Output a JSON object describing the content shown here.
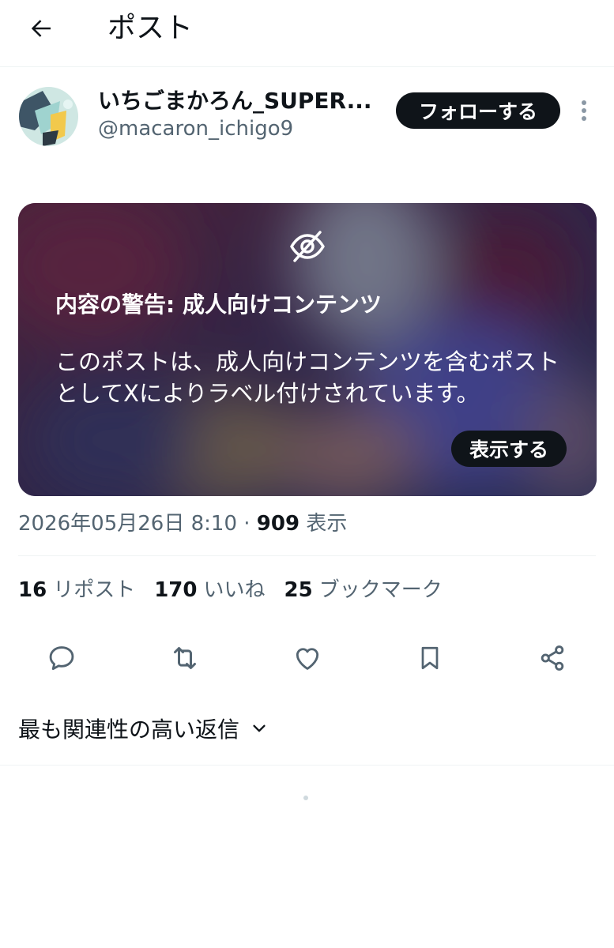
{
  "header": {
    "title": "ポスト",
    "back_icon": "arrow-left-icon"
  },
  "author": {
    "display_name": "いちごまかろん_SUPER...",
    "handle": "@macaron_ichigo9",
    "follow_label": "フォローする",
    "more_icon": "more-vertical-icon"
  },
  "media_warning": {
    "icon": "eye-slash-icon",
    "title": "内容の警告: 成人向けコンテンツ",
    "body": "このポストは、成人向けコンテンツを含むポストとしてXによりラベル付けされています。",
    "show_label": "表示する"
  },
  "meta": {
    "timestamp": "2026年05月26日 8:10",
    "separator": " · ",
    "views": "909",
    "views_label": " 表示"
  },
  "stats": {
    "reposts": {
      "count": "16",
      "label": "リポスト"
    },
    "likes": {
      "count": "170",
      "label": "いいね"
    },
    "bookmarks": {
      "count": "25",
      "label": "ブックマーク"
    }
  },
  "actions": [
    "reply-icon",
    "repost-icon",
    "like-icon",
    "bookmark-icon",
    "share-icon"
  ],
  "replies": {
    "sort_label": "最も関連性の高い返信",
    "sort_icon": "chevron-down-icon"
  },
  "colors": {
    "text_primary": "#0f1419",
    "text_secondary": "#536471",
    "divider": "#eff3f4",
    "button_dark": "#0f1419"
  }
}
